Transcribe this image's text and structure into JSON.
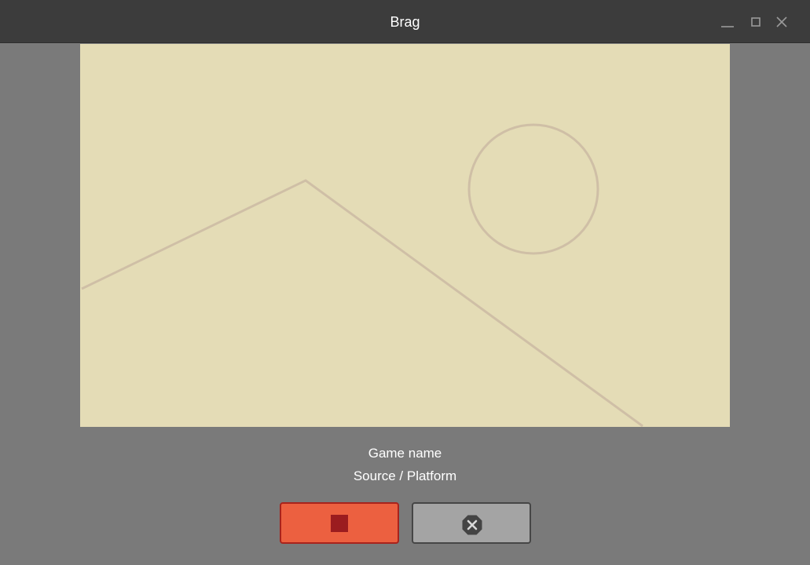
{
  "window": {
    "title": "Brag",
    "controls": [
      "minimize-icon",
      "maximize-icon",
      "close-icon"
    ]
  },
  "preview": {
    "state": "placeholder-image",
    "colors": {
      "background": "#e4dcb6",
      "placeholder_stroke": "#cfbfa6"
    }
  },
  "game": {
    "name": "Game name",
    "source": "Source / Platform"
  },
  "actions": {
    "stop_icon": "stop-square-icon",
    "cancel_icon": "cancel-octagon-icon"
  },
  "colors": {
    "titlebar": "#3c3c3c",
    "window_background": "#7a7a7a",
    "stop_button": "#ec6040",
    "stop_button_border": "#a8231c",
    "stop_icon": "#9b1c1f",
    "cancel_button": "#a4a4a4",
    "cancel_button_border": "#464646"
  }
}
